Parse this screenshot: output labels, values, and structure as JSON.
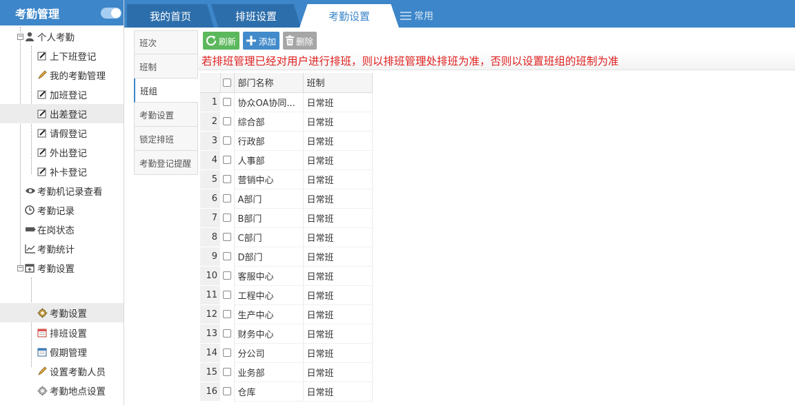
{
  "sidebar": {
    "title": "考勤管理",
    "items": [
      {
        "label": "个人考勤",
        "icon": "user-icon"
      },
      {
        "label": "上下班登记",
        "icon": "edit-icon"
      },
      {
        "label": "我的考勤管理",
        "icon": "pencil-icon"
      },
      {
        "label": "加班登记",
        "icon": "edit-icon"
      },
      {
        "label": "出差登记",
        "icon": "edit-icon"
      },
      {
        "label": "请假登记",
        "icon": "edit-icon"
      },
      {
        "label": "外出登记",
        "icon": "edit-icon"
      },
      {
        "label": "补卡登记",
        "icon": "edit-icon"
      },
      {
        "label": "考勤机记录查看",
        "icon": "eye-icon"
      },
      {
        "label": "考勤记录",
        "icon": "clock-icon"
      },
      {
        "label": "在岗状态",
        "icon": "battery-icon"
      },
      {
        "label": "考勤统计",
        "icon": "line-chart-icon"
      },
      {
        "label": "考勤设置",
        "icon": "calendar-plus-icon"
      },
      {
        "label": "考勤设置",
        "icon": "gear-icon"
      },
      {
        "label": "排班设置",
        "icon": "calendar-icon"
      },
      {
        "label": "假期管理",
        "icon": "calendar-icon"
      },
      {
        "label": "设置考勤人员",
        "icon": "pencil-icon"
      },
      {
        "label": "考勤地点设置",
        "icon": "gear-icon"
      }
    ]
  },
  "tabs": {
    "home": "我的首页",
    "schedule": "排班设置",
    "attendance": "考勤设置",
    "common": "常用"
  },
  "subtabs": [
    "班次",
    "班制",
    "班组",
    "考勤设置",
    "锁定排班",
    "考勤登记提醒"
  ],
  "toolbar": {
    "refresh": "刷新",
    "add": "添加",
    "delete": "删除"
  },
  "notice": "若排班管理已经对用户进行排班，则以排班管理处排班为准，否则以设置班组的班制为准",
  "grid": {
    "headers": [
      "部门名称",
      "班制"
    ],
    "rows": [
      [
        "1",
        "协众OA协同...",
        "日常班"
      ],
      [
        "2",
        "综合部",
        "日常班"
      ],
      [
        "3",
        "行政部",
        "日常班"
      ],
      [
        "4",
        "人事部",
        "日常班"
      ],
      [
        "5",
        "营销中心",
        "日常班"
      ],
      [
        "6",
        "A部门",
        "日常班"
      ],
      [
        "7",
        "B部门",
        "日常班"
      ],
      [
        "8",
        "C部门",
        "日常班"
      ],
      [
        "9",
        "D部门",
        "日常班"
      ],
      [
        "10",
        "客服中心",
        "日常班"
      ],
      [
        "11",
        "工程中心",
        "日常班"
      ],
      [
        "12",
        "生产中心",
        "日常班"
      ],
      [
        "13",
        "财务中心",
        "日常班"
      ],
      [
        "14",
        "分公司",
        "日常班"
      ],
      [
        "15",
        "业务部",
        "日常班"
      ],
      [
        "16",
        "仓库",
        "日常班"
      ]
    ]
  },
  "colors": {
    "header_blue": "#3d86c9",
    "notice_red": "#e02020",
    "refresh_green": "#5cb85c",
    "add_blue": "#428bca",
    "delete_gray": "#a6a6a6"
  }
}
